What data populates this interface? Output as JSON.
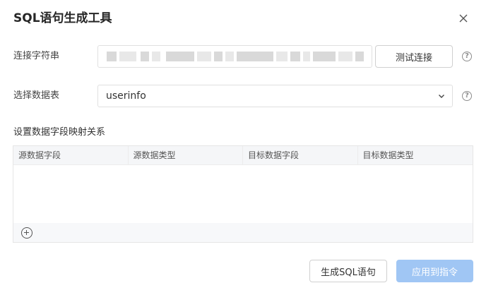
{
  "dialog": {
    "title": "SQL语句生成工具"
  },
  "form": {
    "connection_label": "连接字符串",
    "connection_value": "",
    "test_button": "测试连接",
    "table_label": "选择数据表",
    "table_selected": "userinfo"
  },
  "mapping": {
    "section_title": "设置数据字段映射关系",
    "columns": [
      "源数据字段",
      "源数据类型",
      "目标数据字段",
      "目标数据类型"
    ],
    "rows": []
  },
  "footer": {
    "generate_button": "生成SQL语句",
    "apply_button": "应用到指令"
  },
  "colors": {
    "primary_disabled": "#a0c6f4",
    "border": "#e0e0e0"
  },
  "icons": {
    "close": "close-icon",
    "help": "question-circle-icon",
    "dropdown": "chevron-down-icon",
    "add": "plus-circle-icon"
  }
}
